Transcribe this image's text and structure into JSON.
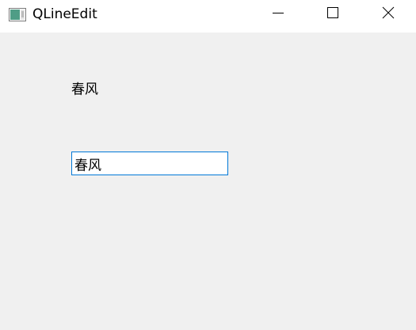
{
  "window": {
    "title": "QLineEdit",
    "buttons": {
      "minimize": "minimize-icon",
      "maximize": "maximize-icon",
      "close": "close-icon"
    }
  },
  "main": {
    "label_text": "春风",
    "line_edit": {
      "value": "春风",
      "placeholder": ""
    }
  },
  "colors": {
    "background": "#f0f0f0",
    "titlebar": "#ffffff",
    "focus_border": "#0078d7"
  }
}
